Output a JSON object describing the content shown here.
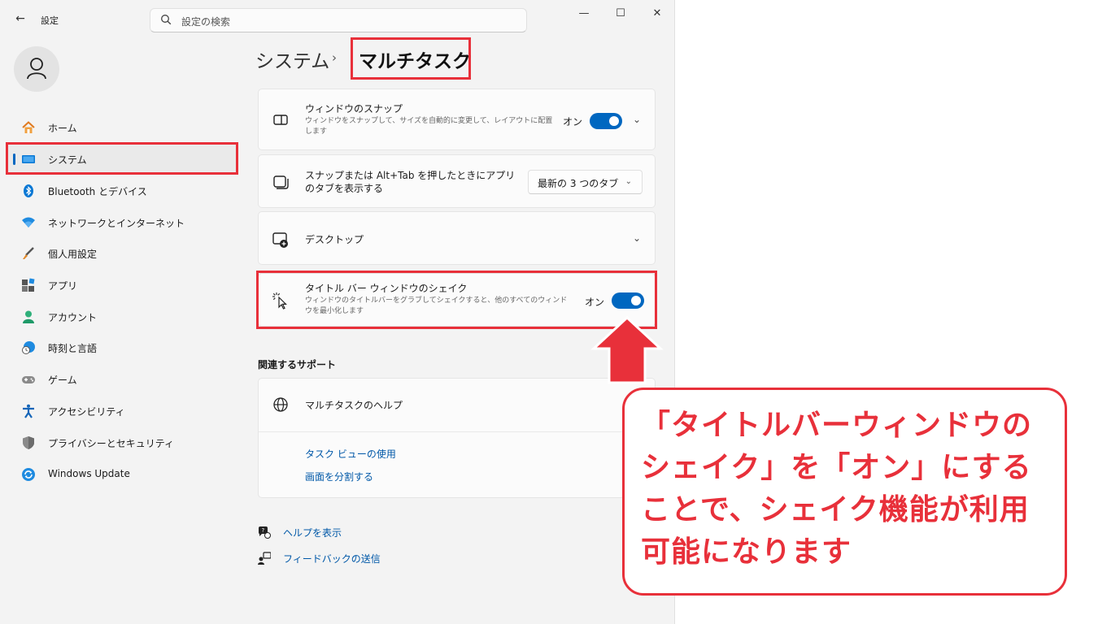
{
  "window": {
    "app_title": "設定",
    "search_placeholder": "設定の検索"
  },
  "sidebar": {
    "items": [
      {
        "label": "ホーム",
        "icon": "home-icon"
      },
      {
        "label": "システム",
        "icon": "system-icon",
        "active": true
      },
      {
        "label": "Bluetooth とデバイス",
        "icon": "bluetooth-icon"
      },
      {
        "label": "ネットワークとインターネット",
        "icon": "wifi-icon"
      },
      {
        "label": "個人用設定",
        "icon": "brush-icon"
      },
      {
        "label": "アプリ",
        "icon": "apps-icon"
      },
      {
        "label": "アカウント",
        "icon": "account-icon"
      },
      {
        "label": "時刻と言語",
        "icon": "time-language-icon"
      },
      {
        "label": "ゲーム",
        "icon": "gamepad-icon"
      },
      {
        "label": "アクセシビリティ",
        "icon": "accessibility-icon"
      },
      {
        "label": "プライバシーとセキュリティ",
        "icon": "shield-icon"
      },
      {
        "label": "Windows Update",
        "icon": "update-icon"
      }
    ]
  },
  "breadcrumb": {
    "parent": "システム",
    "separator": "›",
    "current": "マルチタスク"
  },
  "settings": {
    "snap": {
      "title": "ウィンドウのスナップ",
      "desc": "ウィンドウをスナップして、サイズを自動的に変更して、レイアウトに配置します",
      "state": "オン"
    },
    "alttab": {
      "title": "スナップまたは Alt+Tab を押したときにアプリのタブを表示する",
      "value": "最新の 3 つのタブ"
    },
    "desktops": {
      "title": "デスクトップ"
    },
    "shake": {
      "title": "タイトル バー ウィンドウのシェイク",
      "desc": "ウィンドウのタイトルバーをグラブしてシェイクすると、他のすべてのウィンドウを最小化します",
      "state": "オン"
    }
  },
  "support": {
    "title": "関連するサポート",
    "help_card": "マルチタスクのヘルプ",
    "links": [
      "タスク ビューの使用",
      "画面を分割する"
    ]
  },
  "footer": {
    "help": "ヘルプを表示",
    "feedback": "フィードバックの送信"
  },
  "annotation": {
    "text": "「タイトルバーウィンドウのシェイク」を「オン」にすることで、シェイク機能が利用可能になります",
    "color": "#e8303a"
  },
  "colors": {
    "accent": "#0067c0",
    "link": "#0058a8",
    "highlight": "#e8303a"
  }
}
